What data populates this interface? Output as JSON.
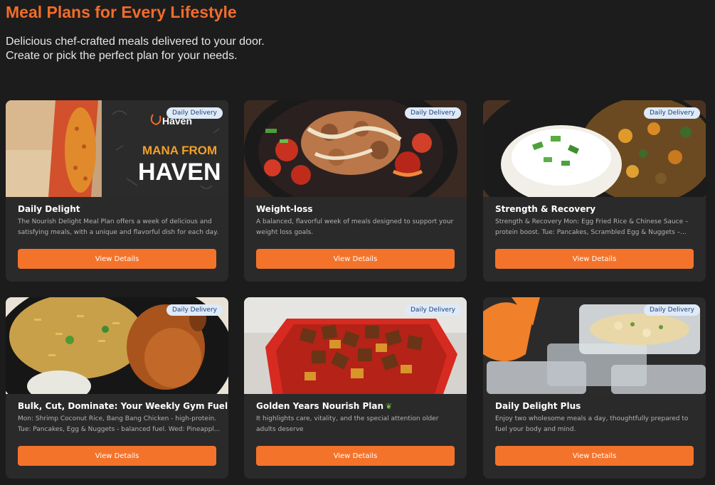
{
  "header": {
    "title": "Meal Plans for Every Lifestyle",
    "subtitle": "Delicious chef-crafted meals delivered to your door. Create or pick the perfect plan for your needs."
  },
  "colors": {
    "accent": "#f4732b",
    "title": "#f26c2b",
    "background": "#1c1c1c",
    "card": "#2a2a2a",
    "badge_bg": "#dfeaf8"
  },
  "cards": [
    {
      "badge": "Daily Delivery",
      "title": "Daily Delight",
      "description": "The Nourish Delight Meal Plan offers a week of delicious and satisfying meals, with a unique and flavorful dish for each day.",
      "button": "View Details",
      "image_text_1": "Haven",
      "image_text_2": "MANA FROM",
      "image_text_3": "HAVEN",
      "image": "haven-bag-with-jollof"
    },
    {
      "badge": "Daily Delivery",
      "title": "Weight-loss",
      "description": "A balanced, flavorful week of meals designed to support your weight loss goals.",
      "button": "View Details",
      "image": "chicken-bowl-with-peppers"
    },
    {
      "badge": "Daily Delivery",
      "title": "Strength & Recovery",
      "description": "Strength & Recovery Mon: Egg Fried Rice & Chinese Sauce – protein boost. Tue: Pancakes, Scrambled Egg & Nuggets –...",
      "button": "View Details",
      "image": "rice-with-vegetable-stew"
    },
    {
      "badge": "Daily Delivery",
      "title": "Bulk, Cut, Dominate: Your Weekly Gym Fuel",
      "description": "Mon: Shrimp Coconut Rice, Bang Bang Chicken - high-protein. Tue: Pancakes, Egg & Nuggets - balanced fuel. Wed: Pineappl...",
      "button": "View Details",
      "image": "rice-with-chicken-leg"
    },
    {
      "badge": "Daily Delivery",
      "title": "Golden Years Nourish Plan",
      "title_icon": "leaf-icon",
      "description": "It highlights care, vitality, and the special attention older adults deserve",
      "button": "View Details",
      "image": "fried-plantain-tray"
    },
    {
      "badge": "Daily Delivery",
      "title": "Daily Delight Plus",
      "description": "Enjoy two wholesome meals a day, thoughtfully prepared to fuel your body and mind.",
      "button": "View Details",
      "image": "meal-prep-containers"
    }
  ]
}
